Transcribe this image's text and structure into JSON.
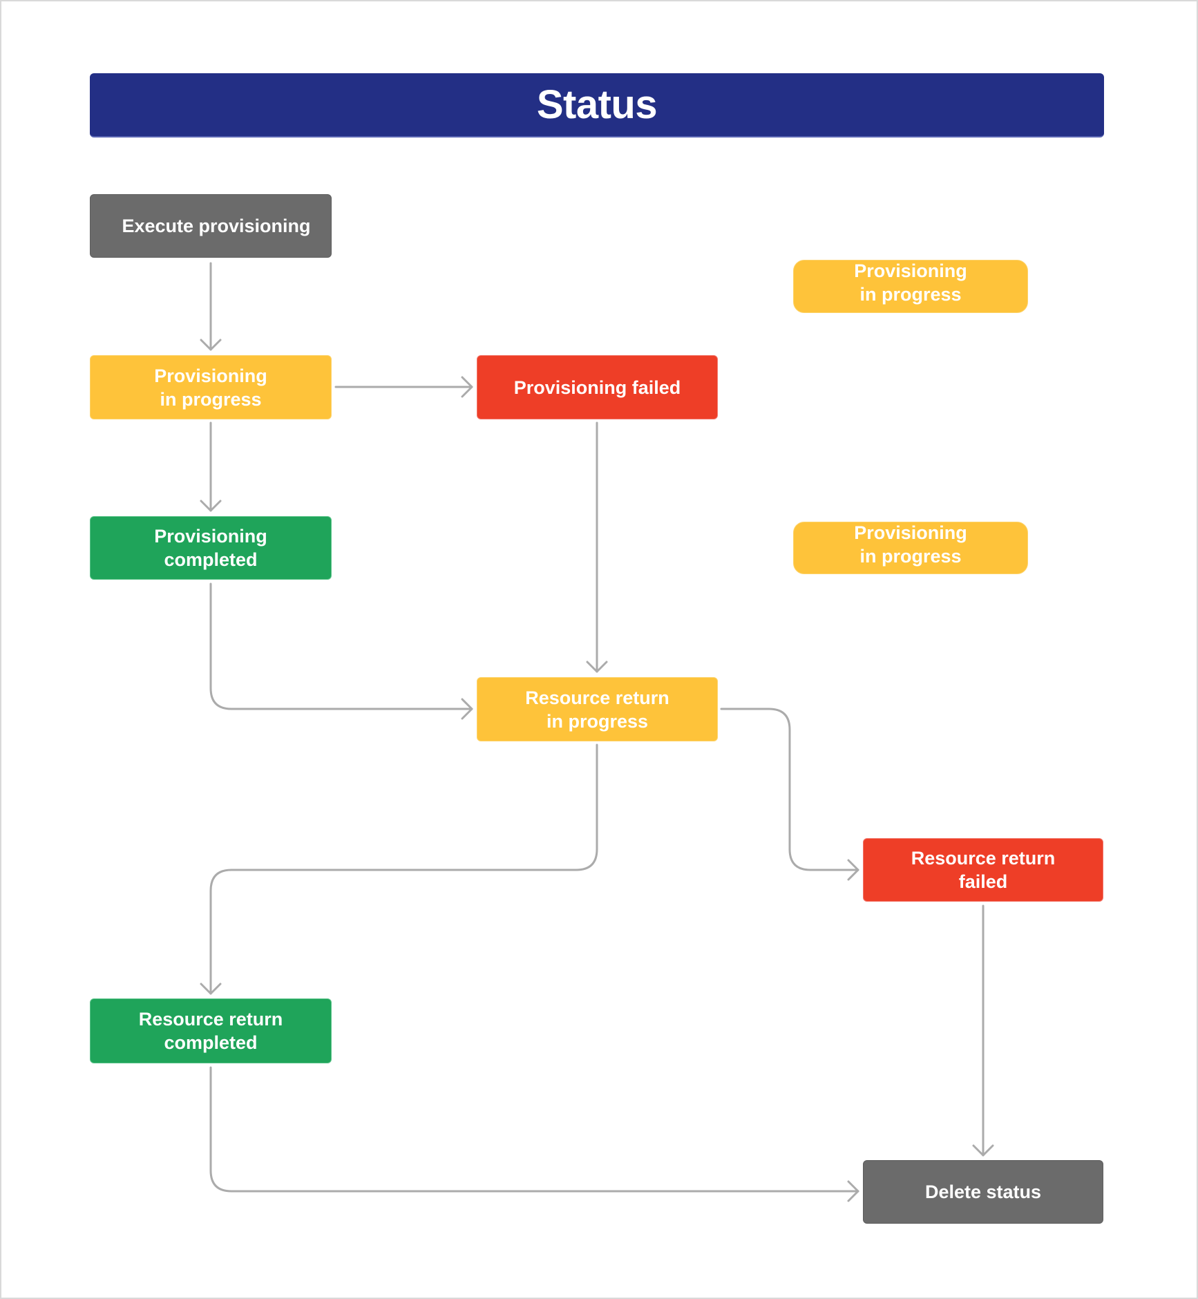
{
  "header": {
    "title": "Status"
  },
  "colors": {
    "header": "#232F85",
    "neutral": "#6B6B6B",
    "in_progress": "#FEC33A",
    "failed": "#EE3E27",
    "completed": "#1FA45A",
    "connector": "#ABABAB"
  },
  "nodes": {
    "execute_provisioning": {
      "label": "Execute provisioning",
      "state": "neutral"
    },
    "provisioning_in_progress": {
      "label": "Provisioning\nin progress",
      "state": "in_progress"
    },
    "provisioning_failed": {
      "label": "Provisioning failed",
      "state": "failed"
    },
    "provisioning_in_progress_alt_1": {
      "label": "Provisioning\nin progress",
      "state": "in_progress"
    },
    "provisioning_completed": {
      "label": "Provisioning\ncompleted",
      "state": "completed"
    },
    "provisioning_in_progress_alt_2": {
      "label": "Provisioning\nin progress",
      "state": "in_progress"
    },
    "resource_return_in_progress": {
      "label": "Resource return\nin progress",
      "state": "in_progress"
    },
    "resource_return_failed": {
      "label": "Resource return\nfailed",
      "state": "failed"
    },
    "resource_return_completed": {
      "label": "Resource return\ncompleted",
      "state": "completed"
    },
    "delete_status": {
      "label": "Delete status",
      "state": "neutral"
    }
  },
  "edges": [
    {
      "from": "execute_provisioning",
      "to": "provisioning_in_progress"
    },
    {
      "from": "provisioning_in_progress",
      "to": "provisioning_failed"
    },
    {
      "from": "provisioning_in_progress",
      "to": "provisioning_completed"
    },
    {
      "from": "provisioning_failed",
      "to": "resource_return_in_progress"
    },
    {
      "from": "provisioning_completed",
      "to": "resource_return_in_progress"
    },
    {
      "from": "resource_return_in_progress",
      "to": "resource_return_completed"
    },
    {
      "from": "resource_return_in_progress",
      "to": "resource_return_failed"
    },
    {
      "from": "resource_return_failed",
      "to": "delete_status"
    },
    {
      "from": "resource_return_completed",
      "to": "delete_status"
    }
  ]
}
